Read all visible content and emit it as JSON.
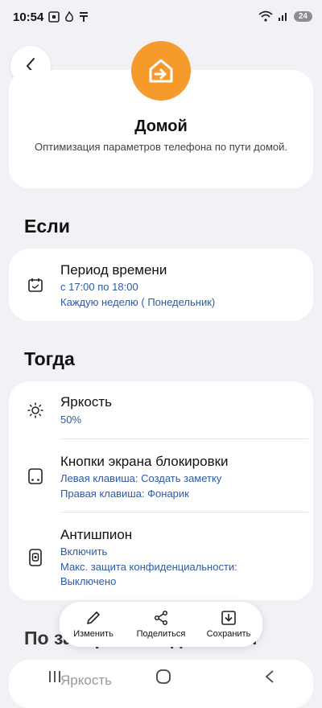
{
  "status_bar": {
    "time": "10:54",
    "battery": "24"
  },
  "hero": {
    "title": "Домой",
    "description": "Оптимизация параметров телефона по пути домой."
  },
  "if_section": {
    "title": "Если",
    "items": [
      {
        "title": "Период времени",
        "lines": [
          "с 17:00 по 18:00",
          "Каждую неделю ( Понедельник)"
        ],
        "icon": "calendar-icon"
      }
    ]
  },
  "then_section": {
    "title": "Тогда",
    "items": [
      {
        "title": "Яркость",
        "lines": [
          "50%"
        ],
        "icon": "brightness-icon"
      },
      {
        "title": "Кнопки экрана блокировки",
        "lines": [
          "Левая клавиша: Создать заметку",
          "Правая клавиша: Фонарик"
        ],
        "icon": "lock-screen-buttons-icon"
      },
      {
        "title": "Антишпион",
        "lines": [
          "Включить",
          "Макс. защита конфиденциальности:",
          "Выключено"
        ],
        "icon": "privacy-screen-icon"
      }
    ]
  },
  "bottom_actions": {
    "edit": "Изменить",
    "share": "Поделиться",
    "save": "Сохранить"
  },
  "next_section": {
    "title": "По завершении действия",
    "first_item": "Яркость"
  },
  "colors": {
    "accent_orange": "#f79a2c",
    "link_blue": "#2c5aa6",
    "background": "#f2f2f6"
  }
}
